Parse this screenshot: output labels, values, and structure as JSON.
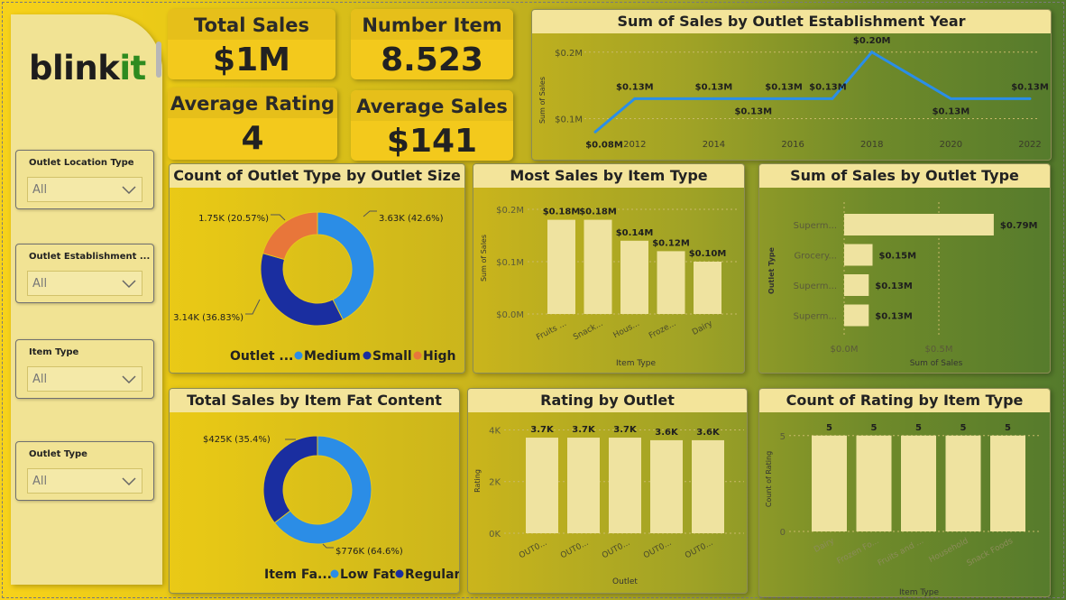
{
  "sidebar": {
    "logo_main": "blink",
    "logo_accent": "it",
    "slicers": [
      {
        "label": "Outlet Location Type",
        "value": "All"
      },
      {
        "label": "Outlet Establishment ...",
        "value": "All"
      },
      {
        "label": "Item Type",
        "value": "All"
      },
      {
        "label": "Outlet Type",
        "value": "All"
      }
    ]
  },
  "kpis": {
    "total_sales": {
      "label": "Total Sales",
      "value": "$1M"
    },
    "number_item": {
      "label": "Number Item",
      "value": "8.523"
    },
    "average_rating": {
      "label": "Average Rating",
      "value": "4"
    },
    "average_sales": {
      "label": "Average Sales",
      "value": "$141"
    }
  },
  "colors": {
    "line": "#2a8ee8",
    "bar": "#efe3a0",
    "medium": "#2b8de6",
    "small": "#1a2ea0",
    "high": "#e8763a"
  },
  "chart_data": [
    {
      "id": "year",
      "type": "line",
      "title": "Sum of Sales by Outlet Establishment Year",
      "ylabel": "Sum of Sales",
      "x": [
        2011,
        2012,
        2014,
        2015,
        2016,
        2017,
        2018,
        2020,
        2022
      ],
      "values": [
        0.08,
        0.13,
        0.13,
        0.13,
        0.13,
        0.13,
        0.2,
        0.13,
        0.13
      ],
      "labels": [
        "$0.08M",
        "$0.13M",
        "$0.13M",
        "$0.13M",
        "$0.13M",
        "$0.13M",
        "$0.20M",
        "$0.13M",
        "$0.13M"
      ],
      "xticks": [
        "2012",
        "2014",
        "2016",
        "2018",
        "2020",
        "2022"
      ],
      "yticks": [
        "$0.1M",
        "$0.2M"
      ],
      "ylim": [
        0.06,
        0.22
      ]
    },
    {
      "id": "outletsize",
      "type": "pie",
      "title": "Count of Outlet Type by Outlet Size",
      "legend_title": "Outlet ...",
      "slices": [
        {
          "name": "Medium",
          "value": 42.6,
          "label": "3.63K (42.6%)"
        },
        {
          "name": "Small",
          "value": 36.83,
          "label": "3.14K (36.83%)"
        },
        {
          "name": "High",
          "value": 20.57,
          "label": "1.75K (20.57%)"
        }
      ]
    },
    {
      "id": "itemtype",
      "type": "bar",
      "title": "Most Sales by Item Type",
      "ylabel": "Sum of Sales",
      "xlabel": "Item Type",
      "categories": [
        "Fruits ...",
        "Snack...",
        "Hous...",
        "Froze...",
        "Dairy"
      ],
      "values": [
        0.18,
        0.18,
        0.14,
        0.12,
        0.1
      ],
      "labels": [
        "$0.18M",
        "$0.18M",
        "$0.14M",
        "$0.12M",
        "$0.10M"
      ],
      "yticks": [
        "$0.0M",
        "$0.1M",
        "$0.2M"
      ],
      "ylim": [
        0,
        0.2
      ]
    },
    {
      "id": "outlettype",
      "type": "bar",
      "title": "Sum of Sales by Outlet Type",
      "ylabel": "Outlet Type",
      "xlabel": "Sum of Sales",
      "categories": [
        "Superm...",
        "Grocery...",
        "Superm...",
        "Superm..."
      ],
      "values": [
        0.79,
        0.15,
        0.13,
        0.13
      ],
      "labels": [
        "$0.79M",
        "$0.15M",
        "$0.13M",
        "$0.13M"
      ],
      "xticks": [
        "$0.0M",
        "$0.5M"
      ],
      "xlim": [
        0,
        1.0
      ]
    },
    {
      "id": "fat",
      "type": "pie",
      "title": "Total Sales by Item Fat Content",
      "legend_title": "Item Fa...",
      "slices": [
        {
          "name": "Low Fat",
          "value": 64.6,
          "label": "$776K (64.6%)"
        },
        {
          "name": "Regular",
          "value": 35.4,
          "label": "$425K (35.4%)"
        }
      ]
    },
    {
      "id": "rating_outlet",
      "type": "bar",
      "title": "Rating by Outlet",
      "ylabel": "Rating",
      "xlabel": "Outlet",
      "categories": [
        "OUT0...",
        "OUT0...",
        "OUT0...",
        "OUT0...",
        "OUT0..."
      ],
      "values": [
        3.7,
        3.7,
        3.7,
        3.6,
        3.6
      ],
      "labels": [
        "3.7K",
        "3.7K",
        "3.7K",
        "3.6K",
        "3.6K"
      ],
      "yticks": [
        "0K",
        "2K",
        "4K"
      ],
      "ylim": [
        0,
        4.4
      ]
    },
    {
      "id": "rating_item",
      "type": "bar",
      "title": "Count of Rating by Item Type",
      "ylabel": "Count of Rating",
      "xlabel": "Item Type",
      "categories": [
        "Dairy",
        "Frozen Fo...",
        "Fruits and ...",
        "Household",
        "Snack Foods"
      ],
      "values": [
        5,
        5,
        5,
        5,
        5
      ],
      "labels": [
        "5",
        "5",
        "5",
        "5",
        "5"
      ],
      "yticks": [
        "0",
        "5"
      ],
      "ylim": [
        0,
        5.6
      ]
    }
  ]
}
